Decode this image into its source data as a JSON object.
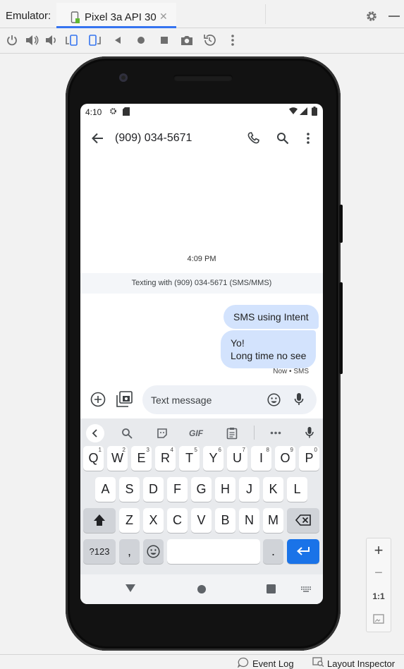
{
  "toolbar": {
    "emulator_label": "Emulator:",
    "tab_title": "Pixel 3a API 30",
    "tab_close_icon": "close-icon",
    "settings_icon": "gear-icon",
    "minimize_icon": "minimize-icon",
    "actions": [
      "power-icon",
      "volume-up-icon",
      "volume-down-icon",
      "rotate-left-icon",
      "rotate-right-icon",
      "back-icon",
      "home-icon",
      "overview-icon",
      "camera-icon",
      "snapshot-icon",
      "more-icon"
    ]
  },
  "device": {
    "status_bar": {
      "time": "4:10"
    },
    "app_bar": {
      "title": "(909) 034-5671"
    },
    "conversation": {
      "timestamp": "4:09 PM",
      "texting_with": "Texting with (909) 034-5671 (SMS/MMS)",
      "messages": [
        {
          "line1": "SMS using Intent"
        },
        {
          "line1": "Yo!",
          "line2": "Long time no see"
        }
      ],
      "meta": "Now • SMS"
    },
    "compose": {
      "placeholder": "Text message"
    },
    "keyboard": {
      "suggestions": [
        "back-chevron-icon",
        "search-icon",
        "sticker-icon",
        "GIF",
        "clipboard-icon",
        "more-icon",
        "mic-icon"
      ],
      "row1": [
        "Q",
        "W",
        "E",
        "R",
        "T",
        "Y",
        "U",
        "I",
        "O",
        "P"
      ],
      "row1_hints": [
        "1",
        "2",
        "3",
        "4",
        "5",
        "6",
        "7",
        "8",
        "9",
        "0"
      ],
      "row2": [
        "A",
        "S",
        "D",
        "F",
        "G",
        "H",
        "J",
        "K",
        "L"
      ],
      "row3": [
        "Z",
        "X",
        "C",
        "V",
        "B",
        "N",
        "M"
      ],
      "row4": {
        "symbols": "?123",
        "comma": ",",
        "period": "."
      }
    }
  },
  "zoom": {
    "plus": "+",
    "minus": "−",
    "one_to_one": "1:1"
  },
  "bottom_bar": {
    "event_log": "Event Log",
    "layout_inspector": "Layout Inspector"
  },
  "colors": {
    "accent": "#3574f0",
    "bubble": "#d3e3fd",
    "enter_key": "#1a73e8"
  }
}
